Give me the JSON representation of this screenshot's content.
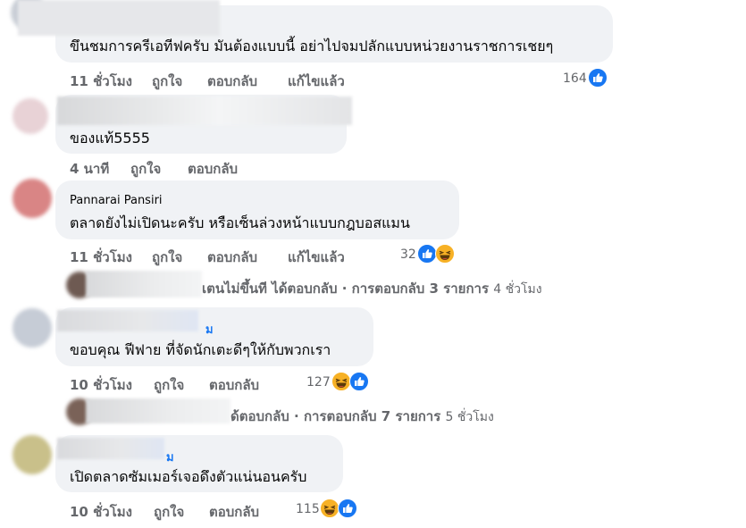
{
  "comments": [
    {
      "text": "ขึนชมการครีเอทีฟครับ มันต้องแบบนี้ อย่าไปจมปลักแบบหน่วยงานราชการเชยๆ",
      "time": "11 ชั่วโมง",
      "like": "ถูกใจ",
      "reply": "ตอบกลับ",
      "edited": "แก้ไขแล้ว",
      "count": "164",
      "reactions": [
        "like-icon"
      ]
    },
    {
      "text": "ของแท้5555",
      "time": "4 นาที",
      "like": "ถูกใจ",
      "reply": "ตอบกลับ"
    },
    {
      "name": "Pannarai Pansiri",
      "text": "ตลาดยังไม่เปิดนะครับ หรือเซ็นล่วงหน้าแบบกฎบอสแมน",
      "time": "11 ชั่วโมง",
      "like": "ถูกใจ",
      "reply": "ตอบกลับ",
      "edited": "แก้ไขแล้ว",
      "count": "32",
      "reactions": [
        "like-icon",
        "haha-icon"
      ]
    },
    {
      "name_tail": "ม",
      "text": "ขอบคุณ ฟีฟาย ที่จัดนักเตะดีๆให้กับพวกเรา",
      "time": "10 ชั่วโมง",
      "like": "ถูกใจ",
      "reply": "ตอบกลับ",
      "count": "127",
      "reactions": [
        "haha-icon",
        "like-icon"
      ]
    },
    {
      "name_tail": "ม",
      "text": "เปิดตลาดซัมเมอร์เจอดึงตัวแน่นอนครับ",
      "time": "10 ชั่วโมง",
      "like": "ถูกใจ",
      "reply": "ตอบกลับ",
      "count": "115",
      "reactions": [
        "haha-icon",
        "like-icon"
      ]
    }
  ],
  "reply_threads": [
    {
      "text": "เตนไม่ขึ้นที ได้ตอบกลับ · การตอบกลับ 3 รายการ",
      "time": "4 ชั่วโมง"
    },
    {
      "text": "ด้ตอบกลับ · การตอบกลับ 7 รายการ",
      "time": "5 ชั่วโมง"
    }
  ],
  "colors": {
    "bubble": "#f0f2f5",
    "meta": "#65676b",
    "like_blue": "#1877f2",
    "haha_yellow": "#f7b125"
  }
}
